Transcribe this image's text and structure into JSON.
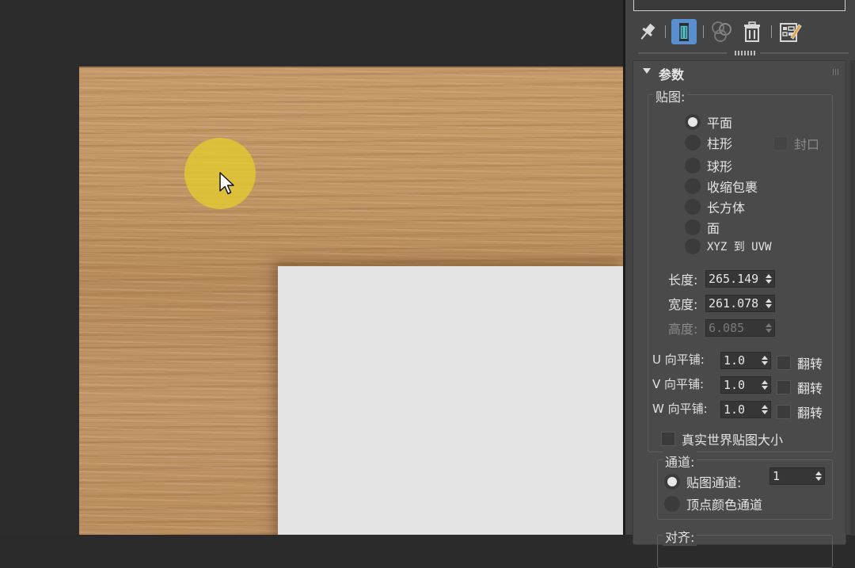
{
  "toolbar": {
    "icons": [
      "pin-icon",
      "uvw-modifier-icon",
      "make-unique-icon",
      "trash-icon",
      "configure-sets-icon"
    ]
  },
  "rollout": {
    "title": "参数",
    "mapping": {
      "title": "贴图:",
      "options": [
        "平面",
        "柱形",
        "球形",
        "收缩包裹",
        "长方体",
        "面",
        "XYZ 到 UVW"
      ],
      "selected": "平面",
      "cap_label": "封口"
    },
    "dimensions": {
      "length_label": "长度:",
      "length_value": "265.149",
      "width_label": "宽度:",
      "width_value": "261.078",
      "height_label": "高度:",
      "height_value": "6.085"
    },
    "tiling": {
      "u_label": "U 向平铺:",
      "u_value": "1.0",
      "v_label": "V 向平铺:",
      "v_value": "1.0",
      "w_label": "W 向平铺:",
      "w_value": "1.0",
      "flip_label": "翻转"
    },
    "real_world_label": "真实世界贴图大小",
    "channel": {
      "title": "通道:",
      "map_channel_label": "贴图通道:",
      "map_channel_value": "1",
      "vertex_color_label": "顶点颜色通道"
    },
    "alignment_title": "对齐:"
  }
}
